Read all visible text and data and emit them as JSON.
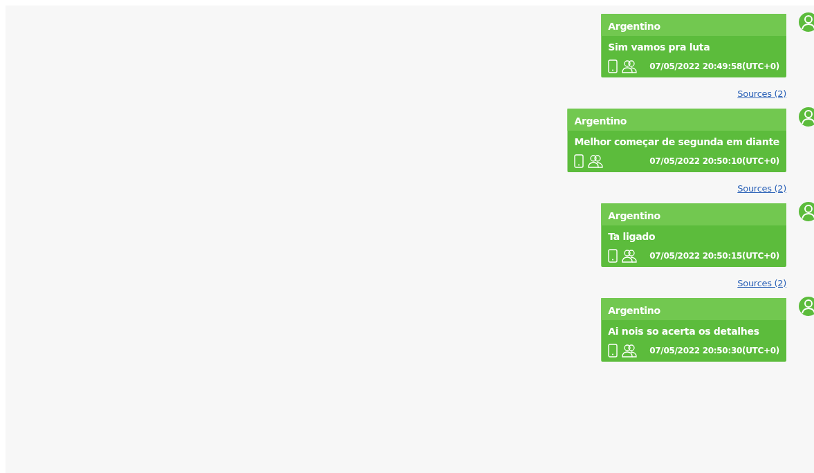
{
  "messages": [
    {
      "sender": "Argentino",
      "text": "Sim vamos  pra luta",
      "timestamp": "07/05/2022 20:49:58(UTC+0)",
      "sources": "Sources (2)"
    },
    {
      "sender": "Argentino",
      "text": "Melhor começar de segunda em diante",
      "timestamp": "07/05/2022 20:50:10(UTC+0)",
      "sources": "Sources (2)"
    },
    {
      "sender": "Argentino",
      "text": "Ta ligado",
      "timestamp": "07/05/2022 20:50:15(UTC+0)",
      "sources": "Sources (2)"
    },
    {
      "sender": "Argentino",
      "text": "Ai nois so acerta os detalhes",
      "timestamp": "07/05/2022 20:50:30(UTC+0)"
    }
  ]
}
